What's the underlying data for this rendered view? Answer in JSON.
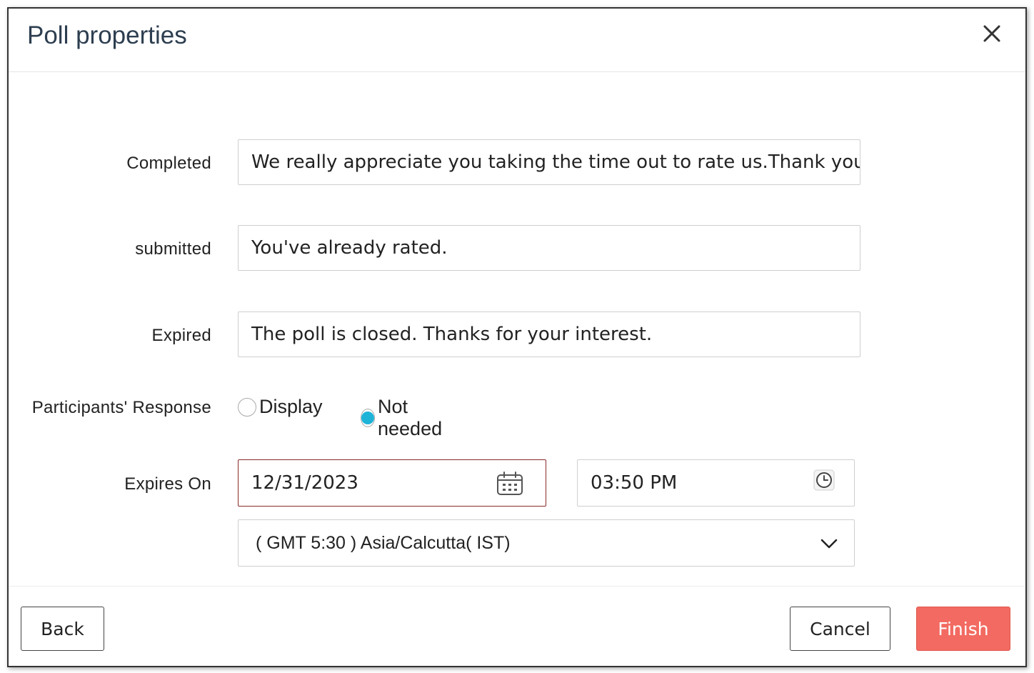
{
  "dialog": {
    "title": "Poll properties",
    "close_icon": "close-icon"
  },
  "messages": {
    "completed": {
      "label": "Completed",
      "value": "We really appreciate you taking the time out to rate us.Thank you"
    },
    "submitted": {
      "label": "submitted",
      "value": "You've already rated."
    },
    "expired": {
      "label": "Expired",
      "value": "The poll is closed. Thanks for your interest."
    }
  },
  "participants_response": {
    "label": "Participants' Response",
    "options": [
      {
        "label": "Display",
        "selected": false
      },
      {
        "label": "Not needed",
        "selected": true
      }
    ],
    "accent_color": "#1fb3d8"
  },
  "expires_on": {
    "label": "Expires On",
    "date": "12/31/2023",
    "date_icon": "calendar-icon",
    "time": "03:50 PM",
    "time_icon": "clock-icon",
    "timezone": "( GMT 5:30 ) Asia/Calcutta( IST)",
    "timezone_icon": "chevron-down-icon"
  },
  "footer": {
    "back_label": "Back",
    "cancel_label": "Cancel",
    "finish_label": "Finish",
    "finish_color": "#f26a61"
  }
}
